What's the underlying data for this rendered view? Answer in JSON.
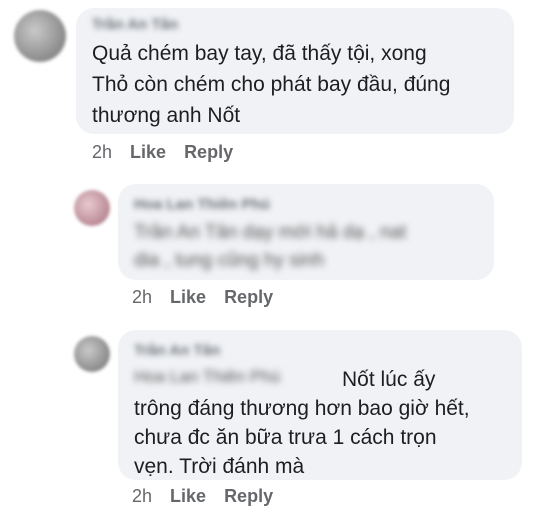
{
  "comments": [
    {
      "author": "Trần An Tân",
      "text_lines": [
        "Quả chém bay tay, đã thấy tội, xong",
        "Thỏ còn chém cho phát bay đầu, đúng",
        "thương anh Nốt"
      ],
      "time": "2h",
      "like": "Like",
      "reply": "Reply"
    },
    {
      "author": "Hoa Lan Thiên Phú",
      "blurred_lines": [
        "Trần An Tân dạy mới hả dạ , nat",
        "dia , tung cũng hy sinh"
      ],
      "time": "2h",
      "like": "Like",
      "reply": "Reply"
    },
    {
      "author": "Trần An Tân",
      "mention": "Hoa Lan Thiên Phú",
      "text_lines": [
        "Nốt lúc ấy",
        "trông đáng thương hơn bao giờ hết,",
        "chưa đc ăn bữa trưa 1 cách trọn",
        "vẹn. Trời đánh mà"
      ],
      "time": "2h",
      "like": "Like",
      "reply": "Reply"
    }
  ]
}
